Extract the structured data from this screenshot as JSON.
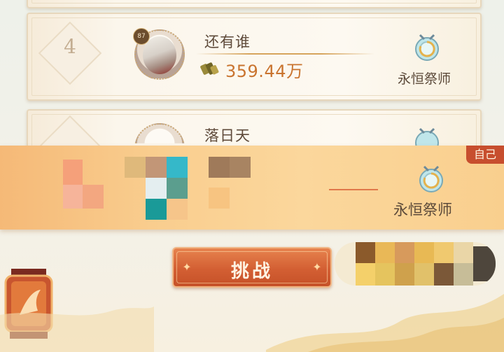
{
  "rows": [
    {
      "rank": "4",
      "level": "87",
      "name": "还有谁",
      "power": "359.44万",
      "title": "永恒祭师"
    },
    {
      "name": "落日天"
    }
  ],
  "self_row": {
    "tag": "自己",
    "title": "永恒祭师"
  },
  "challenge_button": {
    "label": "挑战"
  },
  "colors": {
    "accent": "#d35f33",
    "power_text": "#c9742f",
    "self_bar": "#f9cd8e",
    "self_tag": "#c74e2e"
  },
  "icons": {
    "emblem": "eternal-priest-emblem-icon",
    "power": "battle-power-icon",
    "lantern": "lantern-icon"
  }
}
